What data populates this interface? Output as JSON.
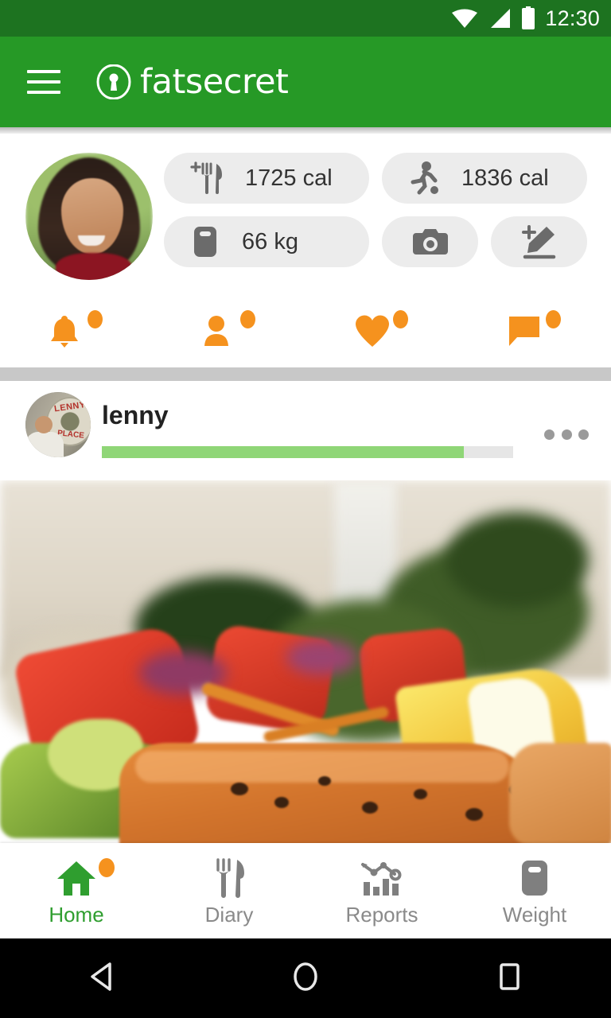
{
  "statusbar": {
    "time": "12:30",
    "icons": [
      "wifi-icon",
      "signal-icon",
      "battery-icon"
    ]
  },
  "appbar": {
    "menu_icon": "hamburger-menu-icon",
    "logo_icon": "fatsecret-logo-icon",
    "brand": "fatsecret",
    "background_color": "#269926"
  },
  "summary": {
    "avatar_name": "user-avatar",
    "pills": [
      {
        "icon": "add-food-icon",
        "value": "1725 cal",
        "name": "food-calories-pill"
      },
      {
        "icon": "exercise-icon",
        "value": "1836 cal",
        "name": "exercise-calories-pill"
      },
      {
        "icon": "weight-scale-icon",
        "value": "66 kg",
        "name": "weight-pill"
      }
    ],
    "camera_icon": "camera-icon",
    "edit_icon": "add-edit-icon"
  },
  "social": {
    "accent_color": "#f5921e",
    "items": [
      {
        "icon": "bell-icon",
        "name": "notifications-button",
        "has_badge": true
      },
      {
        "icon": "person-icon",
        "name": "friends-button",
        "has_badge": true
      },
      {
        "icon": "heart-icon",
        "name": "likes-button",
        "has_badge": true
      },
      {
        "icon": "chat-icon",
        "name": "messages-button",
        "has_badge": true
      }
    ]
  },
  "post": {
    "author": "lenny",
    "avatar_name": "post-author-avatar",
    "menu_icon": "overflow-menu-icon",
    "progress_percent": 88,
    "progress_color": "#8fd677",
    "image_name": "food-photo"
  },
  "bottomnav": {
    "active_color": "#2f9e2f",
    "inactive_color": "#8a8a8a",
    "items": [
      {
        "label": "Home",
        "icon": "home-icon",
        "active": true,
        "has_badge": true
      },
      {
        "label": "Diary",
        "icon": "diary-icon",
        "active": false,
        "has_badge": false
      },
      {
        "label": "Reports",
        "icon": "reports-icon",
        "active": false,
        "has_badge": false
      },
      {
        "label": "Weight",
        "icon": "weight-icon",
        "active": false,
        "has_badge": false
      }
    ]
  },
  "androidnav": {
    "back": "back-triangle-icon",
    "home": "home-circle-icon",
    "recents": "recents-square-icon"
  }
}
